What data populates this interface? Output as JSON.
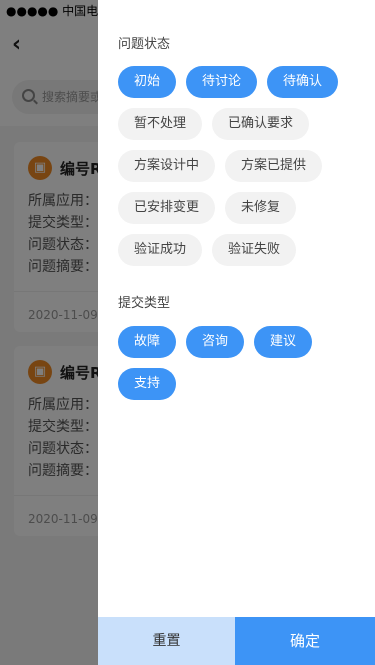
{
  "status_bar": {
    "text": "●●●●● 中国电信"
  },
  "search": {
    "placeholder": "搜索摘要或编号"
  },
  "cards": [
    {
      "title": "编号R",
      "rows": [
        "所属应用：",
        "提交类型：",
        "问题状态：",
        "问题摘要："
      ],
      "date": "2020-11-09"
    },
    {
      "title": "编号R",
      "rows": [
        "所属应用：",
        "提交类型：",
        "问题状态：",
        "问题摘要："
      ],
      "date": "2020-11-09"
    }
  ],
  "filter": {
    "status_title": "问题状态",
    "status_tags": [
      {
        "label": "初始",
        "selected": true
      },
      {
        "label": "待讨论",
        "selected": true
      },
      {
        "label": "待确认",
        "selected": true
      },
      {
        "label": "暂不处理",
        "selected": false
      },
      {
        "label": "已确认要求",
        "selected": false
      },
      {
        "label": "方案设计中",
        "selected": false
      },
      {
        "label": "方案已提供",
        "selected": false
      },
      {
        "label": "已安排变更",
        "selected": false
      },
      {
        "label": "未修复",
        "selected": false
      },
      {
        "label": "验证成功",
        "selected": false
      },
      {
        "label": "验证失败",
        "selected": false
      }
    ],
    "type_title": "提交类型",
    "type_tags": [
      {
        "label": "故障",
        "selected": true
      },
      {
        "label": "咨询",
        "selected": true
      },
      {
        "label": "建议",
        "selected": true
      },
      {
        "label": "支持",
        "selected": true
      }
    ],
    "reset_label": "重置",
    "confirm_label": "确定"
  },
  "colors": {
    "accent": "#3d94f6",
    "reset_bg": "#c9e0fb",
    "tag_off_bg": "#f2f2f2"
  }
}
